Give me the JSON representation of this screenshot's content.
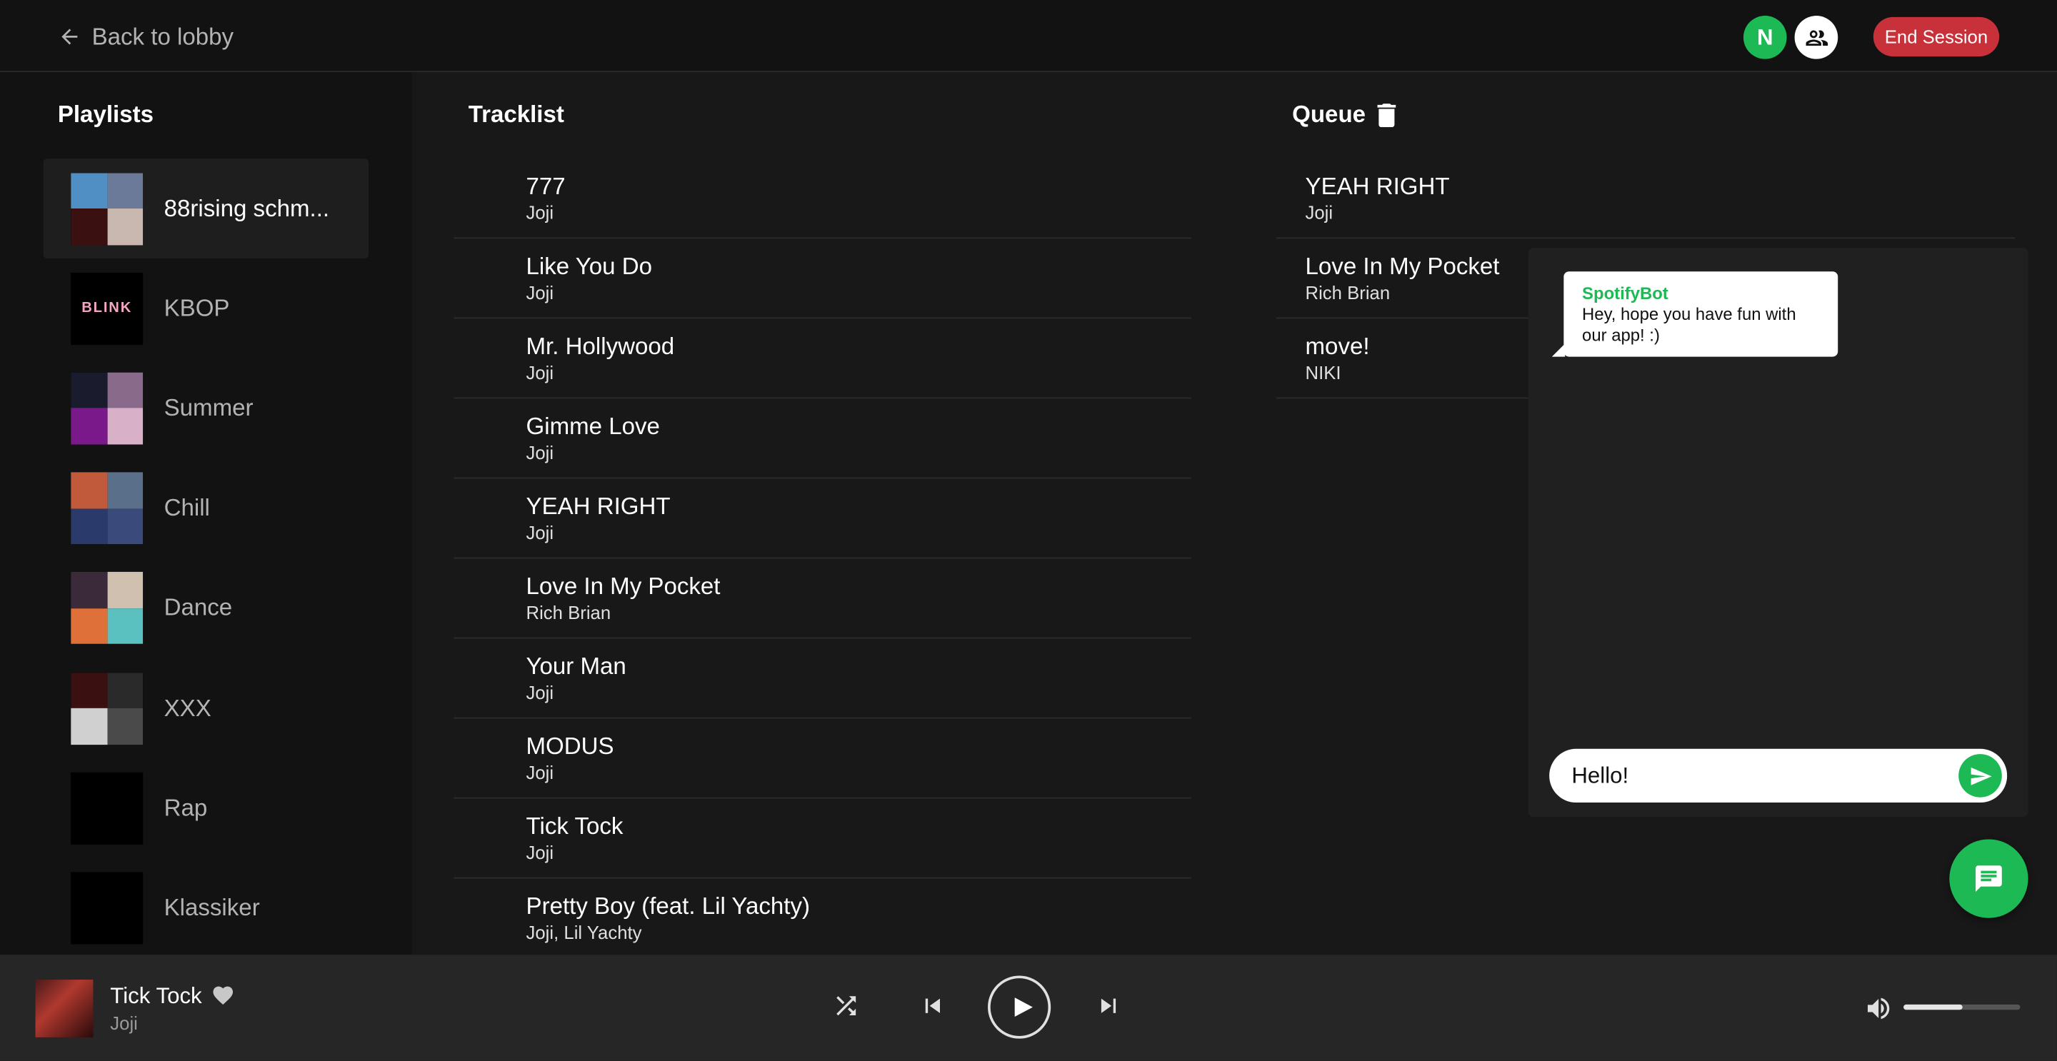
{
  "topbar": {
    "back_label": "Back to lobby",
    "avatar_initial": "N",
    "end_session_label": "End Session"
  },
  "playlists": {
    "title": "Playlists",
    "items": [
      {
        "name": "88rising schm...",
        "active": true,
        "colors": [
          "#4f8fc4",
          "#6b7a99",
          "#3a1010",
          "#c9b8b0"
        ]
      },
      {
        "name": "KBOP",
        "active": false,
        "colors": [
          "#000000",
          "#000000",
          "#000000",
          "#000000"
        ],
        "badge": "BLINK"
      },
      {
        "name": "Summer",
        "active": false,
        "colors": [
          "#1b1b2e",
          "#8a6a8a",
          "#7a1a8a",
          "#d8b0c8"
        ]
      },
      {
        "name": "Chill",
        "active": false,
        "colors": [
          "#c05a3a",
          "#5a6f8a",
          "#2a3a6a",
          "#3a4a7a"
        ]
      },
      {
        "name": "Dance",
        "active": false,
        "colors": [
          "#3a2a3a",
          "#d0c0b0",
          "#e0703a",
          "#5ac0c0"
        ]
      },
      {
        "name": "XXX",
        "active": false,
        "colors": [
          "#3a1010",
          "#2a2a2a",
          "#d0d0d0",
          "#4a4a4a"
        ]
      },
      {
        "name": "Rap",
        "active": false,
        "colors": [
          "#000000",
          "#000000",
          "#000000",
          "#000000"
        ]
      },
      {
        "name": "Klassiker",
        "active": false,
        "colors": [
          "#000000",
          "#000000",
          "#000000",
          "#000000"
        ]
      }
    ]
  },
  "tracklist": {
    "title": "Tracklist",
    "items": [
      {
        "title": "777",
        "artist": "Joji"
      },
      {
        "title": "Like You Do",
        "artist": "Joji"
      },
      {
        "title": "Mr. Hollywood",
        "artist": "Joji"
      },
      {
        "title": "Gimme Love",
        "artist": "Joji"
      },
      {
        "title": "YEAH RIGHT",
        "artist": "Joji"
      },
      {
        "title": "Love In My Pocket",
        "artist": "Rich Brian"
      },
      {
        "title": "Your Man",
        "artist": "Joji"
      },
      {
        "title": "MODUS",
        "artist": "Joji"
      },
      {
        "title": "Tick Tock",
        "artist": "Joji"
      },
      {
        "title": "Pretty Boy (feat. Lil Yachty)",
        "artist": "Joji, Lil Yachty"
      }
    ]
  },
  "queue": {
    "title": "Queue",
    "items": [
      {
        "title": "YEAH RIGHT",
        "artist": "Joji"
      },
      {
        "title": "Love In My Pocket",
        "artist": "Rich Brian"
      },
      {
        "title": "move!",
        "artist": "NIKI"
      }
    ]
  },
  "chat": {
    "sender": "SpotifyBot",
    "message": "Hey, hope you have fun with our app! :)",
    "input_value": "Hello!"
  },
  "player": {
    "title": "Tick Tock",
    "artist": "Joji",
    "volume_fraction": 0.5
  },
  "colors": {
    "accent": "#1db954",
    "danger": "#c8313a"
  }
}
